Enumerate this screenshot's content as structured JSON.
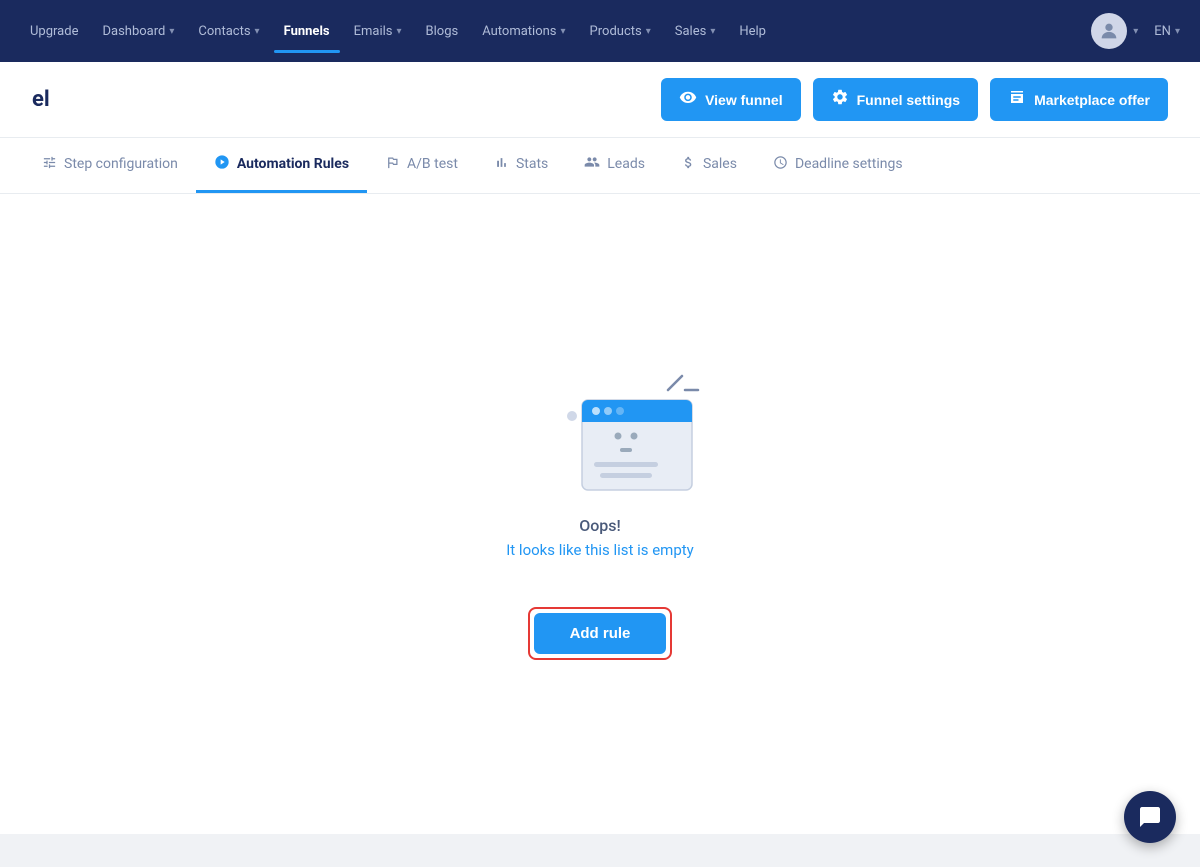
{
  "navbar": {
    "items": [
      {
        "label": "Upgrade",
        "hasArrow": false,
        "active": false
      },
      {
        "label": "Dashboard",
        "hasArrow": true,
        "active": false
      },
      {
        "label": "Contacts",
        "hasArrow": true,
        "active": false
      },
      {
        "label": "Funnels",
        "hasArrow": false,
        "active": true
      },
      {
        "label": "Emails",
        "hasArrow": true,
        "active": false
      },
      {
        "label": "Blogs",
        "hasArrow": false,
        "active": false
      },
      {
        "label": "Automations",
        "hasArrow": true,
        "active": false
      },
      {
        "label": "Products",
        "hasArrow": true,
        "active": false
      },
      {
        "label": "Sales",
        "hasArrow": true,
        "active": false
      },
      {
        "label": "Help",
        "hasArrow": false,
        "active": false
      }
    ],
    "lang": "EN"
  },
  "header": {
    "title": "el",
    "buttons": {
      "view_funnel": "View funnel",
      "funnel_settings": "Funnel settings",
      "marketplace_offer": "Marketplace offer"
    }
  },
  "tabs": [
    {
      "label": "Step configuration",
      "icon": "⚙",
      "active": false
    },
    {
      "label": "Automation Rules",
      "icon": "⚡",
      "active": true
    },
    {
      "label": "A/B test",
      "icon": "🔀",
      "active": false
    },
    {
      "label": "Stats",
      "icon": "📊",
      "active": false
    },
    {
      "label": "Leads",
      "icon": "👥",
      "active": false
    },
    {
      "label": "Sales",
      "icon": "💲",
      "active": false
    },
    {
      "label": "Deadline settings",
      "icon": "🕐",
      "active": false
    }
  ],
  "empty_state": {
    "title": "Oops!",
    "subtitle": "It looks like this list is empty"
  },
  "add_rule_button": "Add rule"
}
